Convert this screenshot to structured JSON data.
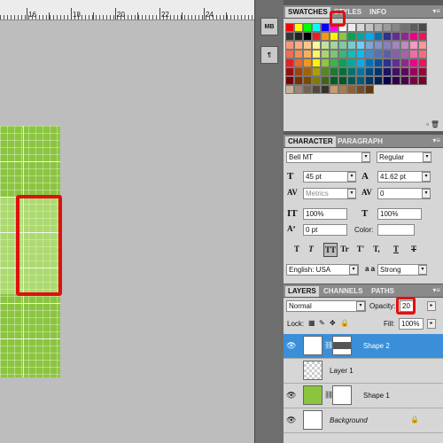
{
  "ruler": {
    "ticks": [
      "16",
      "18",
      "20",
      "22",
      "24"
    ]
  },
  "swatches_panel": {
    "tabs": [
      "SWATCHES",
      "STYLES",
      "INFO"
    ],
    "menu": "▾≡",
    "colors": [
      [
        "#ff0000",
        "#ffff00",
        "#00ff00",
        "#00ffff",
        "#0000ff",
        "#ff00ff",
        "#ffffff",
        "#ebebeb",
        "#d7d7d7",
        "#c3c3c3",
        "#afafaf",
        "#9b9b9b",
        "#878787",
        "#737373",
        "#5f5f5f",
        "#4b4b4b"
      ],
      [
        "#373737",
        "#232323",
        "#000000",
        "#ee1d24",
        "#f7941d",
        "#fff200",
        "#8dc63f",
        "#00a651",
        "#00a99d",
        "#00aeef",
        "#0072bc",
        "#2e3192",
        "#662d91",
        "#92278f",
        "#ec008c",
        "#ed145b"
      ],
      [
        "#f7977a",
        "#fbad82",
        "#fdc68c",
        "#fff799",
        "#c6df9c",
        "#a4d49d",
        "#81ca9d",
        "#7bcdc9",
        "#6ccff7",
        "#7ca6d8",
        "#8293ca",
        "#8881be",
        "#a286bd",
        "#bc8cbf",
        "#f49bc1",
        "#f5999d"
      ],
      [
        "#f26c4f",
        "#f68e55",
        "#fbaf5a",
        "#fff467",
        "#acd372",
        "#7dc473",
        "#39b778",
        "#16bcb4",
        "#00bff3",
        "#438ccb",
        "#5573b7",
        "#5e5ca7",
        "#855fa8",
        "#a763a9",
        "#ef6ea8",
        "#f16d7e"
      ],
      [
        "#ed1c24",
        "#f26522",
        "#f7941d",
        "#fff200",
        "#8dc63f",
        "#39b54a",
        "#00a651",
        "#00a99d",
        "#00aeef",
        "#0072bc",
        "#0054a5",
        "#2e3192",
        "#662d91",
        "#92278f",
        "#ec008c",
        "#ed145a"
      ],
      [
        "#9e0b0f",
        "#a0410d",
        "#a3620a",
        "#aba000",
        "#598527",
        "#1a7b30",
        "#007236",
        "#00746b",
        "#0076a4",
        "#004b80",
        "#003370",
        "#1b1464",
        "#440e62",
        "#630460",
        "#9b005d",
        "#9e0039"
      ],
      [
        "#790000",
        "#7b2e00",
        "#7d4900",
        "#827b00",
        "#406618",
        "#005e20",
        "#005826",
        "#005952",
        "#005b7f",
        "#003663",
        "#002157",
        "#0d004c",
        "#32004b",
        "#4b0049",
        "#7b0046",
        "#7a0026"
      ],
      [
        "#c7b299",
        "#998675",
        "#736357",
        "#534741",
        "#37302a",
        "#c69c6d",
        "#a67c52",
        "#8c6239",
        "#754c24",
        "#603913"
      ]
    ]
  },
  "character_panel": {
    "tabs": [
      "CHARACTER",
      "PARAGRAPH"
    ],
    "font_family": "Bell MT",
    "font_style": "Regular",
    "font_size": "45 pt",
    "leading": "41.62 pt",
    "kerning": "Metrics",
    "tracking": "0",
    "vertical_scale": "100%",
    "horizontal_scale": "100%",
    "baseline_shift": "0 pt",
    "color_label": "Color:",
    "type_buttons": [
      "T",
      "T",
      "TT",
      "Tr",
      "T'",
      "T,",
      "T",
      "T"
    ],
    "language": "English: USA",
    "aa_label": "a a",
    "antialias": "Strong"
  },
  "layers_panel": {
    "tabs": [
      "LAYERS",
      "CHANNELS",
      "PATHS"
    ],
    "blend_mode": "Normal",
    "opacity_label": "Opacity:",
    "opacity_value": "20",
    "lock_label": "Lock:",
    "fill_label": "Fill:",
    "fill_value": "100%",
    "layers": [
      {
        "name": "Shape 2",
        "selected": true
      },
      {
        "name": "Layer 1",
        "selected": false
      },
      {
        "name": "Shape 1",
        "selected": false
      },
      {
        "name": "Background",
        "selected": false
      }
    ]
  },
  "toolstrip": {
    "tool1": "MB",
    "tool2": "¶"
  },
  "colors": {
    "highlight": "#e01010",
    "selection": "#3a8fd8",
    "shape_green": "#8bc540"
  }
}
